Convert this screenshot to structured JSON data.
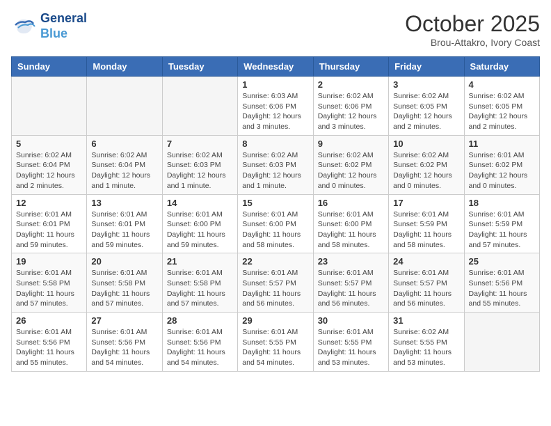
{
  "header": {
    "logo_line1": "General",
    "logo_line2": "Blue",
    "month": "October 2025",
    "location": "Brou-Attakro, Ivory Coast"
  },
  "weekdays": [
    "Sunday",
    "Monday",
    "Tuesday",
    "Wednesday",
    "Thursday",
    "Friday",
    "Saturday"
  ],
  "weeks": [
    [
      {
        "day": "",
        "info": ""
      },
      {
        "day": "",
        "info": ""
      },
      {
        "day": "",
        "info": ""
      },
      {
        "day": "1",
        "info": "Sunrise: 6:03 AM\nSunset: 6:06 PM\nDaylight: 12 hours and 3 minutes."
      },
      {
        "day": "2",
        "info": "Sunrise: 6:02 AM\nSunset: 6:06 PM\nDaylight: 12 hours and 3 minutes."
      },
      {
        "day": "3",
        "info": "Sunrise: 6:02 AM\nSunset: 6:05 PM\nDaylight: 12 hours and 2 minutes."
      },
      {
        "day": "4",
        "info": "Sunrise: 6:02 AM\nSunset: 6:05 PM\nDaylight: 12 hours and 2 minutes."
      }
    ],
    [
      {
        "day": "5",
        "info": "Sunrise: 6:02 AM\nSunset: 6:04 PM\nDaylight: 12 hours and 2 minutes."
      },
      {
        "day": "6",
        "info": "Sunrise: 6:02 AM\nSunset: 6:04 PM\nDaylight: 12 hours and 1 minute."
      },
      {
        "day": "7",
        "info": "Sunrise: 6:02 AM\nSunset: 6:03 PM\nDaylight: 12 hours and 1 minute."
      },
      {
        "day": "8",
        "info": "Sunrise: 6:02 AM\nSunset: 6:03 PM\nDaylight: 12 hours and 1 minute."
      },
      {
        "day": "9",
        "info": "Sunrise: 6:02 AM\nSunset: 6:02 PM\nDaylight: 12 hours and 0 minutes."
      },
      {
        "day": "10",
        "info": "Sunrise: 6:02 AM\nSunset: 6:02 PM\nDaylight: 12 hours and 0 minutes."
      },
      {
        "day": "11",
        "info": "Sunrise: 6:01 AM\nSunset: 6:02 PM\nDaylight: 12 hours and 0 minutes."
      }
    ],
    [
      {
        "day": "12",
        "info": "Sunrise: 6:01 AM\nSunset: 6:01 PM\nDaylight: 11 hours and 59 minutes."
      },
      {
        "day": "13",
        "info": "Sunrise: 6:01 AM\nSunset: 6:01 PM\nDaylight: 11 hours and 59 minutes."
      },
      {
        "day": "14",
        "info": "Sunrise: 6:01 AM\nSunset: 6:00 PM\nDaylight: 11 hours and 59 minutes."
      },
      {
        "day": "15",
        "info": "Sunrise: 6:01 AM\nSunset: 6:00 PM\nDaylight: 11 hours and 58 minutes."
      },
      {
        "day": "16",
        "info": "Sunrise: 6:01 AM\nSunset: 6:00 PM\nDaylight: 11 hours and 58 minutes."
      },
      {
        "day": "17",
        "info": "Sunrise: 6:01 AM\nSunset: 5:59 PM\nDaylight: 11 hours and 58 minutes."
      },
      {
        "day": "18",
        "info": "Sunrise: 6:01 AM\nSunset: 5:59 PM\nDaylight: 11 hours and 57 minutes."
      }
    ],
    [
      {
        "day": "19",
        "info": "Sunrise: 6:01 AM\nSunset: 5:58 PM\nDaylight: 11 hours and 57 minutes."
      },
      {
        "day": "20",
        "info": "Sunrise: 6:01 AM\nSunset: 5:58 PM\nDaylight: 11 hours and 57 minutes."
      },
      {
        "day": "21",
        "info": "Sunrise: 6:01 AM\nSunset: 5:58 PM\nDaylight: 11 hours and 57 minutes."
      },
      {
        "day": "22",
        "info": "Sunrise: 6:01 AM\nSunset: 5:57 PM\nDaylight: 11 hours and 56 minutes."
      },
      {
        "day": "23",
        "info": "Sunrise: 6:01 AM\nSunset: 5:57 PM\nDaylight: 11 hours and 56 minutes."
      },
      {
        "day": "24",
        "info": "Sunrise: 6:01 AM\nSunset: 5:57 PM\nDaylight: 11 hours and 56 minutes."
      },
      {
        "day": "25",
        "info": "Sunrise: 6:01 AM\nSunset: 5:56 PM\nDaylight: 11 hours and 55 minutes."
      }
    ],
    [
      {
        "day": "26",
        "info": "Sunrise: 6:01 AM\nSunset: 5:56 PM\nDaylight: 11 hours and 55 minutes."
      },
      {
        "day": "27",
        "info": "Sunrise: 6:01 AM\nSunset: 5:56 PM\nDaylight: 11 hours and 54 minutes."
      },
      {
        "day": "28",
        "info": "Sunrise: 6:01 AM\nSunset: 5:56 PM\nDaylight: 11 hours and 54 minutes."
      },
      {
        "day": "29",
        "info": "Sunrise: 6:01 AM\nSunset: 5:55 PM\nDaylight: 11 hours and 54 minutes."
      },
      {
        "day": "30",
        "info": "Sunrise: 6:01 AM\nSunset: 5:55 PM\nDaylight: 11 hours and 53 minutes."
      },
      {
        "day": "31",
        "info": "Sunrise: 6:02 AM\nSunset: 5:55 PM\nDaylight: 11 hours and 53 minutes."
      },
      {
        "day": "",
        "info": ""
      }
    ]
  ]
}
